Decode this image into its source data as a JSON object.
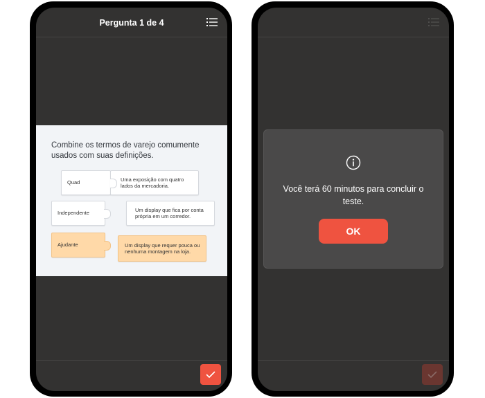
{
  "left_screen": {
    "header": {
      "title": "Pergunta 1 de 4",
      "menu_icon": "list-icon"
    },
    "question": {
      "prompt": "Combine os termos de varejo comumente usados com suas definições.",
      "terms": [
        {
          "label": "Quad",
          "selected": false
        },
        {
          "label": "Independente",
          "selected": false
        },
        {
          "label": "Ajudante",
          "selected": true
        }
      ],
      "definitions": [
        "Uma exposição com quatro lados da mercadoria.",
        "Um display que fica por conta própria em um corredor.",
        "Um display que requer pouca ou nenhuma montagem na loja."
      ]
    },
    "footer": {
      "submit_icon": "check-icon",
      "accent": "#ef5340"
    }
  },
  "right_screen": {
    "modal": {
      "icon": "info-icon",
      "message": "Você terá 60 minutos para concluir o teste.",
      "ok_label": "OK"
    }
  },
  "colors": {
    "background": "#333231",
    "accent": "#ef5340",
    "selected_piece": "#ffd9a8"
  }
}
